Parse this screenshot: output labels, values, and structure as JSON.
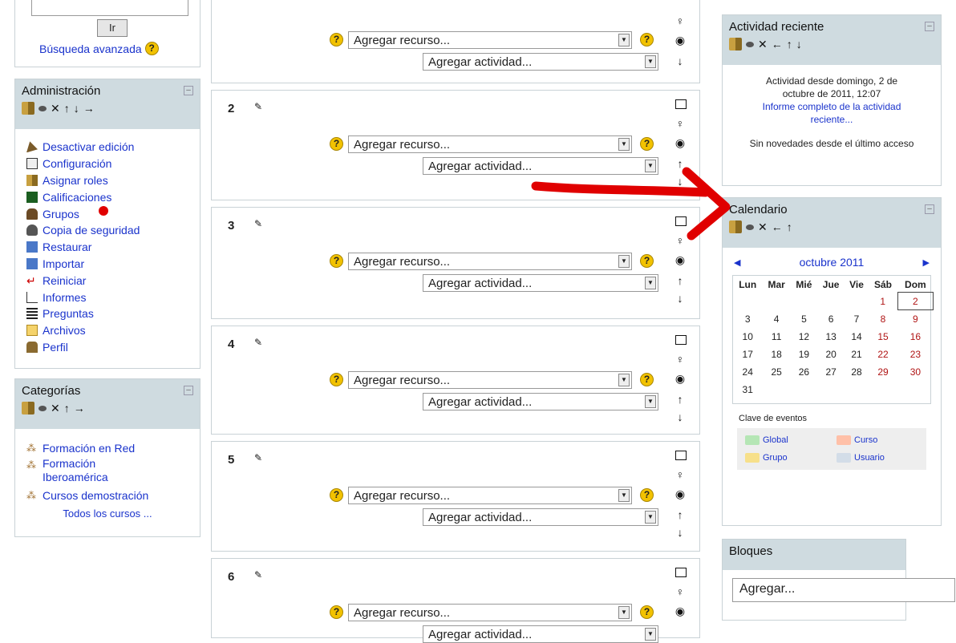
{
  "search": {
    "go_label": "Ir",
    "advanced_label": "Búsqueda avanzada"
  },
  "admin": {
    "title": "Administración",
    "items": [
      {
        "label": "Desactivar edición",
        "icon": "edit-off-icon"
      },
      {
        "label": "Configuración",
        "icon": "settings-icon"
      },
      {
        "label": "Asignar roles",
        "icon": "roles-icon"
      },
      {
        "label": "Calificaciones",
        "icon": "grades-icon"
      },
      {
        "label": "Grupos",
        "icon": "groups-icon"
      },
      {
        "label": "Copia de seguridad",
        "icon": "backup-icon"
      },
      {
        "label": "Restaurar",
        "icon": "restore-icon"
      },
      {
        "label": "Importar",
        "icon": "import-icon"
      },
      {
        "label": "Reiniciar",
        "icon": "reset-icon"
      },
      {
        "label": "Informes",
        "icon": "reports-icon"
      },
      {
        "label": "Preguntas",
        "icon": "questions-icon"
      },
      {
        "label": "Archivos",
        "icon": "folder-icon"
      },
      {
        "label": "Perfil",
        "icon": "profile-icon"
      }
    ]
  },
  "categories": {
    "title": "Categorías",
    "items": [
      {
        "label": "Formación en Red"
      },
      {
        "label": "Formación Iberoamérica"
      },
      {
        "label": "Cursos demostración"
      }
    ],
    "all_courses": "Todos los cursos ..."
  },
  "sections": {
    "add_resource": "Agregar recurso...",
    "add_activity": "Agregar actividad...",
    "numbers": [
      "2",
      "3",
      "4",
      "5",
      "6"
    ]
  },
  "recent": {
    "title": "Actividad reciente",
    "since": "Actividad desde domingo, 2 de octubre de 2011, 12:07",
    "full_report": "Informe completo de la actividad reciente...",
    "no_news": "Sin novedades desde el último acceso"
  },
  "calendar": {
    "title": "Calendario",
    "month": "octubre 2011",
    "weekdays": [
      "Lun",
      "Mar",
      "Mié",
      "Jue",
      "Vie",
      "Sáb",
      "Dom"
    ],
    "weeks": [
      [
        "",
        "",
        "",
        "",
        "",
        "1",
        "2"
      ],
      [
        "3",
        "4",
        "5",
        "6",
        "7",
        "8",
        "9"
      ],
      [
        "10",
        "11",
        "12",
        "13",
        "14",
        "15",
        "16"
      ],
      [
        "17",
        "18",
        "19",
        "20",
        "21",
        "22",
        "23"
      ],
      [
        "24",
        "25",
        "26",
        "27",
        "28",
        "29",
        "30"
      ],
      [
        "31",
        "",
        "",
        "",
        "",
        "",
        ""
      ]
    ],
    "legend_title": "Clave de eventos",
    "legend": [
      {
        "label": "Global",
        "color": "#b5e6b5"
      },
      {
        "label": "Curso",
        "color": "#ffc0a8"
      },
      {
        "label": "Grupo",
        "color": "#f7e08a"
      },
      {
        "label": "Usuario",
        "color": "#d3dde8"
      }
    ]
  },
  "blocks": {
    "title": "Bloques",
    "select_value": "Agregar..."
  },
  "colors": {
    "link": "#1a33cc",
    "block_header": "#cfdbe0",
    "weekend": "#b01515",
    "annotation_red": "#e00000"
  }
}
